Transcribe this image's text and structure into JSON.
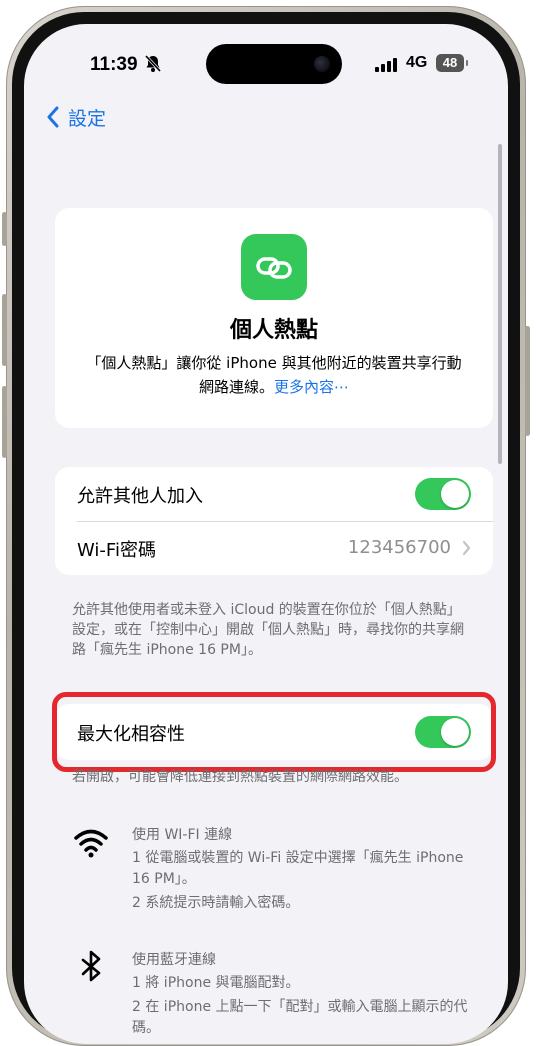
{
  "status_bar": {
    "time": "11:39",
    "network": "4G",
    "battery": "48"
  },
  "nav": {
    "back_label": "設定"
  },
  "hero": {
    "title": "個人熱點",
    "description": "「個人熱點」讓你從 iPhone 與其他附近的裝置共享行動網路連線。",
    "more_link": "更多內容⋯"
  },
  "settings": {
    "allow_others_label": "允許其他人加入",
    "allow_others_on": true,
    "wifi_password_label": "Wi-Fi密碼",
    "wifi_password_value": "123456700"
  },
  "footnote_allow": "允許其他使用者或未登入 iCloud 的裝置在你位於「個人熱點」設定，或在「控制中心」開啟「個人熱點」時，尋找你的共享網路「瘋先生 iPhone 16 PM」。",
  "maximize": {
    "label": "最大化相容性",
    "on": true,
    "footnote": "若開啟，可能會降低連接到熱點裝置的網際網路效能。"
  },
  "instructions": {
    "wifi": {
      "title": "使用 WI-FI 連線",
      "step1": "1 從電腦或裝置的 Wi-Fi 設定中選擇「瘋先生 iPhone 16 PM」。",
      "step2": "2 系統提示時請輸入密碼。"
    },
    "bluetooth": {
      "title": "使用藍牙連線",
      "step1": "1 將 iPhone 與電腦配對。",
      "step2": "2 在 iPhone 上點一下「配對」或輸入電腦上顯示的代碼。"
    }
  },
  "colors": {
    "accent_blue": "#1a73e8",
    "toggle_green": "#34c759",
    "highlight_red": "#e5282e",
    "background": "#f2f2f7"
  }
}
